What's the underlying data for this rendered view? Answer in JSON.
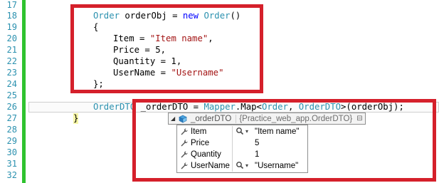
{
  "gutter": {
    "line_numbers": [
      "17",
      "18",
      "19",
      "20",
      "21",
      "22",
      "23",
      "24",
      "25",
      "26",
      "27",
      "28",
      "29",
      "30",
      "31",
      "32"
    ]
  },
  "code": {
    "line18": {
      "kw_type": "Order",
      "var": " orderObj = ",
      "kw_new": "new",
      "space": " ",
      "ctor": "Order",
      "args": "()"
    },
    "line19": "{",
    "line20": {
      "prop": "Item = ",
      "str": "\"Item name\"",
      "end": ","
    },
    "line21": "Price = 5,",
    "line22": "Quantity = 1,",
    "line23": {
      "prop": "UserName = ",
      "str": "\"Username\""
    },
    "line24": "};",
    "line26": {
      "type1": "OrderDTO",
      "var": " _orderDTO = ",
      "mapper": "Mapper",
      "map": ".Map<",
      "order": "Order",
      "comma": ", ",
      "dto": "OrderDTO",
      "call": ">(orderObj);"
    },
    "line27": "}"
  },
  "datatip": {
    "expand_glyph": "◢",
    "object_icon": "object-cube-icon",
    "name": "_orderDTO",
    "type": "{Practice_web_app.OrderDTO}",
    "pin_glyph": "⊟",
    "members": [
      {
        "name": "Item",
        "value": "\"Item name\"",
        "has_visualizer": true
      },
      {
        "name": "Price",
        "value": "5",
        "has_visualizer": false
      },
      {
        "name": "Quantity",
        "value": "1",
        "has_visualizer": false
      },
      {
        "name": "UserName",
        "value": "\"Username\"",
        "has_visualizer": true
      }
    ],
    "caret_glyph": "▾"
  },
  "colors": {
    "keyword": "#0000ff",
    "type": "#2b91af",
    "string": "#a31515",
    "annotation_box": "#d5202b",
    "change_bar": "#2fc32f"
  }
}
